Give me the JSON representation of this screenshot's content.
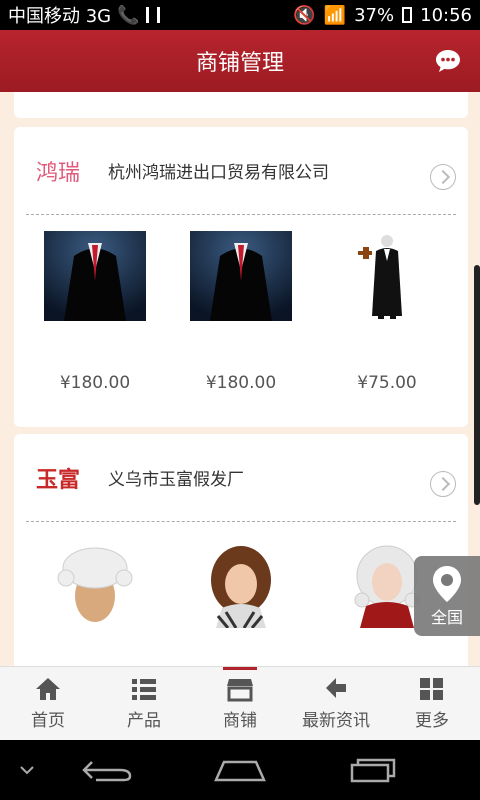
{
  "status": {
    "carrier": "中国移动 3G",
    "battery": "37%",
    "time": "10:56"
  },
  "header": {
    "title": "商铺管理"
  },
  "shops": [
    {
      "logo": "鸿瑞",
      "name": "杭州鸿瑞进出口贸易有限公司",
      "products": [
        {
          "price": "¥180.00"
        },
        {
          "price": "¥180.00"
        },
        {
          "price": "¥75.00"
        }
      ]
    },
    {
      "logo": "玉富",
      "name": "义乌市玉富假发厂",
      "products": [
        {
          "price": ""
        },
        {
          "price": ""
        },
        {
          "price": ""
        }
      ]
    }
  ],
  "float_button": {
    "label": "全国"
  },
  "nav": {
    "items": [
      {
        "label": "首页",
        "icon": "home-icon"
      },
      {
        "label": "产品",
        "icon": "list-icon"
      },
      {
        "label": "商铺",
        "icon": "shop-icon"
      },
      {
        "label": "最新资讯",
        "icon": "news-icon"
      },
      {
        "label": "更多",
        "icon": "grid-icon"
      }
    ],
    "active_index": 2
  },
  "colors": {
    "header": "#b3232c",
    "accent": "#b3232c"
  }
}
